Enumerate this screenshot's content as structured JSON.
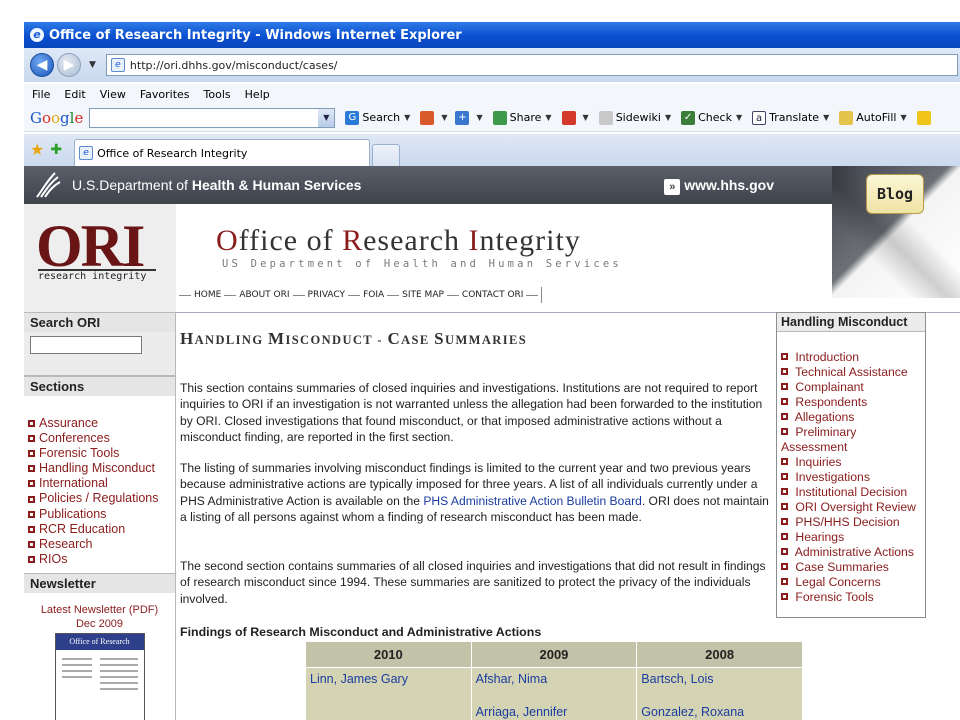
{
  "window": {
    "title": "Office of Research Integrity - Windows Internet Explorer",
    "url": "http://ori.dhhs.gov/misconduct/cases/"
  },
  "menu": [
    "File",
    "Edit",
    "View",
    "Favorites",
    "Tools",
    "Help"
  ],
  "google_toolbar": {
    "logo": "Google",
    "search_label": "Search",
    "share_label": "Share",
    "sidewiki_label": "Sidewiki",
    "check_label": "Check",
    "translate_label": "Translate",
    "autofill_label": "AutoFill"
  },
  "tab": {
    "label": "Office of Research Integrity"
  },
  "banner": {
    "dept_prefix": "U.S.Department of ",
    "dept_name": "Health & Human Services",
    "hhs_url": "www.hhs.gov",
    "blog": "Blog",
    "logo_text": "ORI",
    "logo_sub": "research integrity",
    "title_letters": [
      {
        "cap": "O",
        "rest": "ffice of "
      },
      {
        "cap": "R",
        "rest": "esearch "
      },
      {
        "cap": "I",
        "rest": "ntegrity"
      }
    ],
    "subtitle": "US Department of Health and Human Services"
  },
  "topnav": [
    "HOME",
    "ABOUT ORI",
    "PRIVACY",
    "FOIA",
    "SITE MAP",
    "CONTACT ORI"
  ],
  "sidebar": {
    "search_heading": "Search ORI",
    "sections_heading": "Sections",
    "sections": [
      "Assurance",
      "Conferences",
      "Forensic Tools",
      "Handling Misconduct",
      "International",
      "Policies / Regulations",
      "Publications",
      "RCR Education",
      "Research",
      "RIOs"
    ],
    "newsletter_heading": "Newsletter",
    "newsletter_link": "Latest Newsletter (PDF)",
    "newsletter_date": "Dec 2009",
    "newsletter_thumb_title": "Office of Research Integrity"
  },
  "article": {
    "title": "Handling Misconduct - Case Summaries",
    "para1": "This section contains summaries of closed inquiries and investigations. Institutions are not required to report inquiries to ORI if an investigation is not warranted unless the allegation had been forwarded to the institution by ORI. Closed investigations that found misconduct, or that imposed administrative actions without a misconduct finding, are reported in the first section.",
    "para2_a": "The listing of summaries involving misconduct findings is limited to the current year and two previous years because administrative actions are typically imposed for three years. A list of all individuals currently under a PHS Administrative Action is available on the ",
    "para2_link": "PHS Administrative Action Bulletin Board",
    "para2_b": ".  ORI does not maintain a listing of all persons against whom a finding of research misconduct has been made.",
    "para3": "The second section contains summaries of all closed inquiries and investigations that did not result in findings of research misconduct since 1994. These summaries are sanitized to protect the privacy of the individuals involved.",
    "findings_heading": "Findings of Research Misconduct and Administrative Actions",
    "table": {
      "headers": [
        "2010",
        "2009",
        "2008"
      ],
      "columns": [
        [
          "Linn, James Gary"
        ],
        [
          "Afshar, Nima",
          "Arriaga, Jennifer"
        ],
        [
          "Bartsch, Lois",
          "Gonzalez, Roxana"
        ]
      ]
    }
  },
  "rightbox": {
    "heading": "Handling Misconduct",
    "items": [
      "Introduction",
      "Technical Assistance",
      "Complainant",
      "Respondents",
      "Allegations",
      "Preliminary",
      "Inquiries",
      "Investigations",
      "Institutional Decision",
      "ORI Oversight Review",
      "PHS/HHS Decision",
      "Hearings",
      "Administrative Actions",
      "Case Summaries",
      "Legal Concerns",
      "Forensic Tools"
    ],
    "preliminary_cont": "Assessment"
  },
  "colors": {
    "maroon": "#8a1c1c",
    "link_blue": "#1a3c9e",
    "ie_blue": "#0a4fd0",
    "table_bg": "#d4d4b4"
  }
}
